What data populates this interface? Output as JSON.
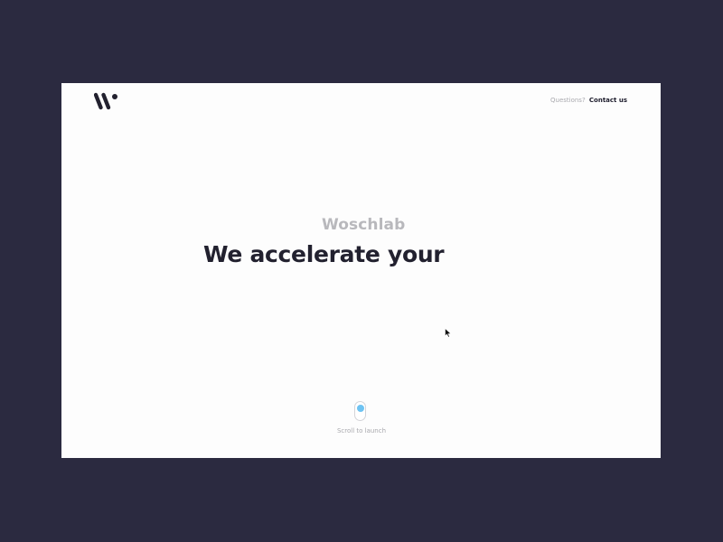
{
  "header": {
    "logo_alt": "W",
    "questions_label": "Questions?",
    "contact_label": "Contact us"
  },
  "hero": {
    "subtitle": "Woschlab",
    "title": "We accelerate your"
  },
  "scroll": {
    "label": "Scroll to launch"
  },
  "colors": {
    "background": "#2b2a40",
    "page": "#fdfdfd",
    "title": "#22212f",
    "subtitle": "#b8b8bc",
    "accent": "#6ec3f2"
  },
  "icons": {
    "logo": "w-logo-icon",
    "cursor": "cursor-arrow-icon",
    "scroll": "mouse-scroll-icon"
  }
}
